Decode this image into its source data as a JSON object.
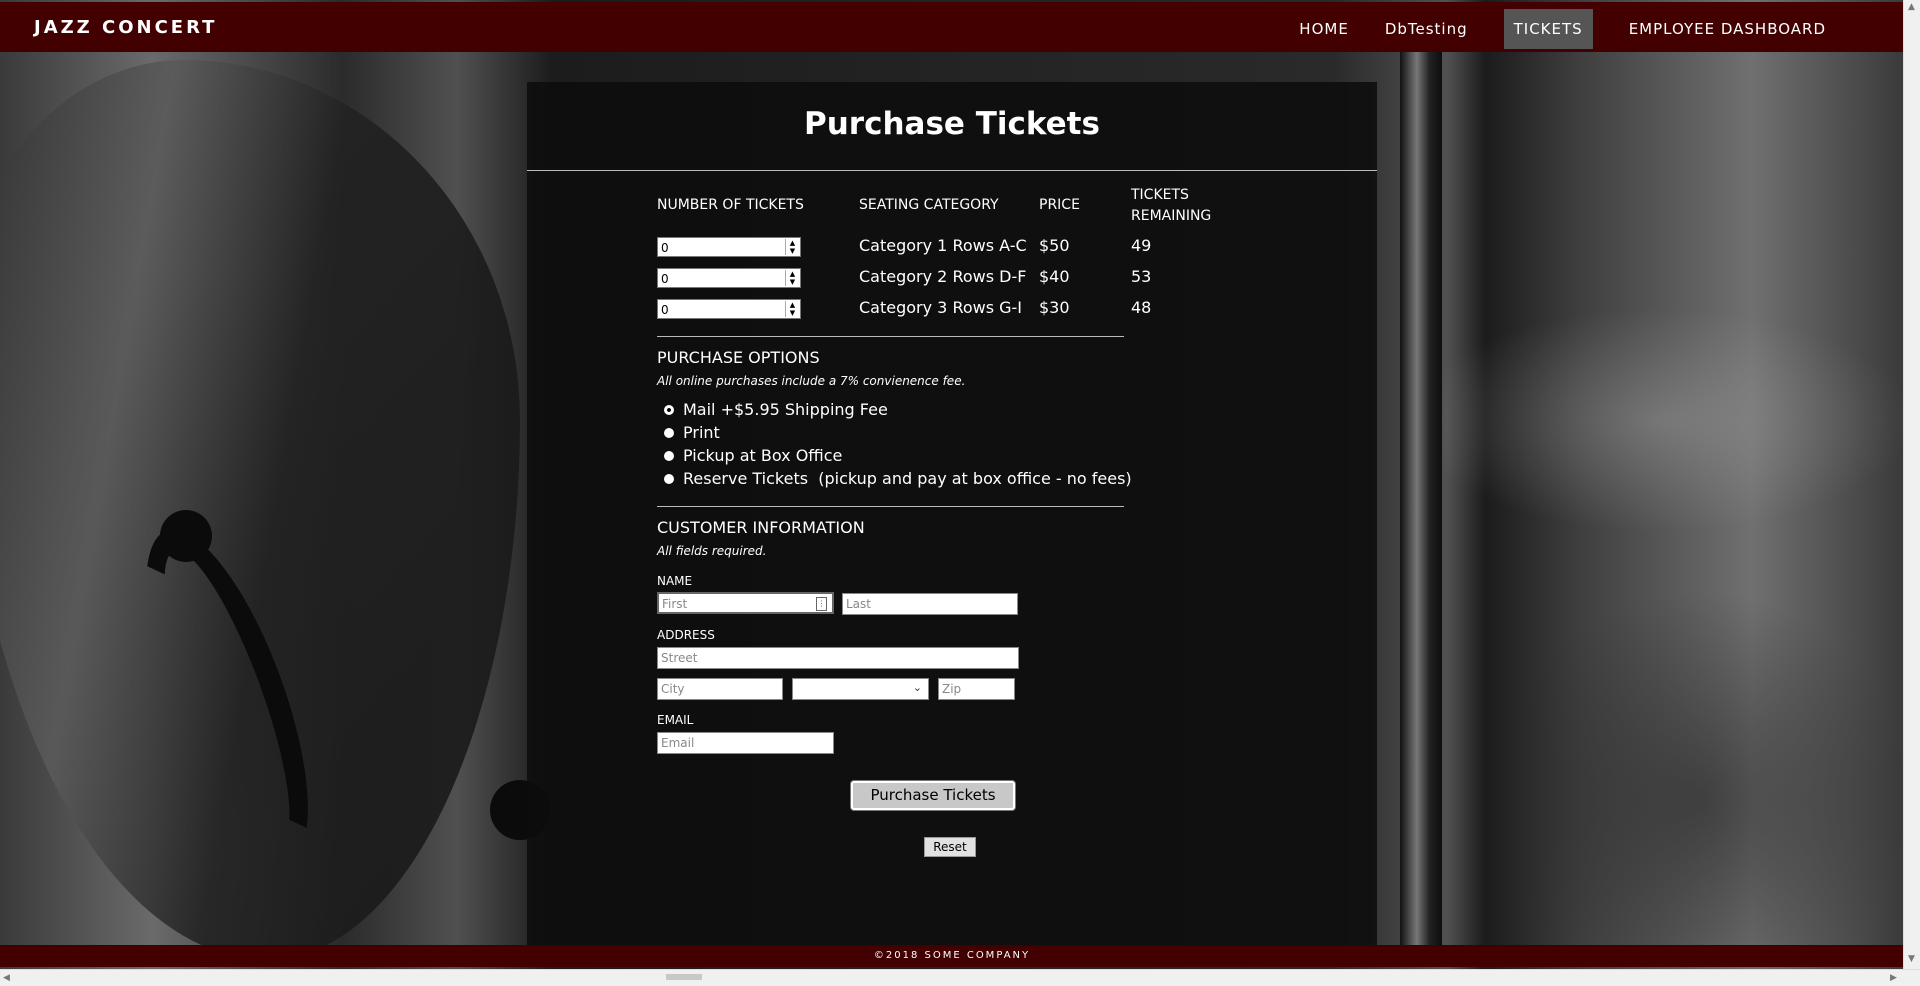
{
  "brand": "JAZZ CONCERT",
  "nav": {
    "items": [
      "HOME",
      "DbTesting",
      "TICKETS",
      "EMPLOYEE DASHBOARD"
    ],
    "active": "TICKETS",
    "bar_color": "#420000"
  },
  "panel": {
    "title": "Purchase Tickets"
  },
  "tickets": {
    "headers": {
      "number": "NUMBER OF TICKETS",
      "category": "SEATING CATEGORY",
      "price": "PRICE",
      "remaining_line1": "TICKETS",
      "remaining_line2": "REMAINING"
    },
    "rows": [
      {
        "qty": "0",
        "category": "Category 1 Rows A-C",
        "price": "$50",
        "remaining": "49"
      },
      {
        "qty": "0",
        "category": "Category 2 Rows D-F",
        "price": "$40",
        "remaining": "53"
      },
      {
        "qty": "0",
        "category": "Category 3 Rows G-I",
        "price": "$30",
        "remaining": "48"
      }
    ]
  },
  "purchase_options": {
    "title": "PURCHASE OPTIONS",
    "note": "All online purchases include a 7% convienence fee.",
    "options": [
      "Mail +$5.95 Shipping Fee",
      "Print",
      "Pickup at Box Office",
      "Reserve Tickets  (pickup and pay at box office - no fees)"
    ]
  },
  "customer": {
    "title": "CUSTOMER INFORMATION",
    "note": "All fields required.",
    "name_label": "NAME",
    "first_placeholder": "First",
    "last_placeholder": "Last",
    "address_label": "ADDRESS",
    "street_placeholder": "Street",
    "city_placeholder": "City",
    "state_value": "",
    "zip_placeholder": "Zip",
    "email_label": "EMAIL",
    "email_placeholder": "Email"
  },
  "buttons": {
    "purchase": "Purchase Tickets",
    "reset": "Reset"
  },
  "footer": "©2018 SOME COMPANY"
}
